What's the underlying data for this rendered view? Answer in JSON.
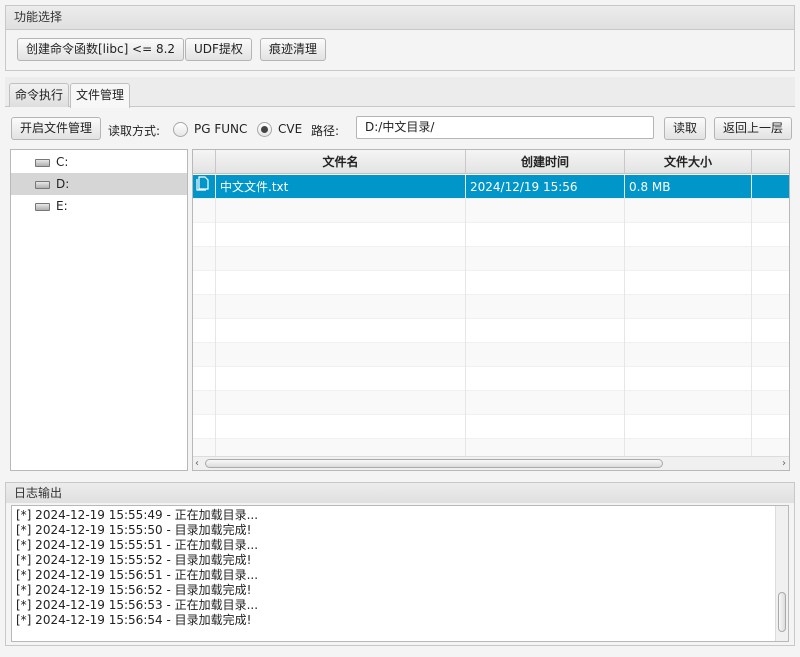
{
  "function_panel": {
    "title": "功能选择",
    "buttons": [
      "创建命令函数[libc] <= 8.2",
      "UDF提权",
      "痕迹清理"
    ]
  },
  "tabs": [
    "命令执行",
    "文件管理"
  ],
  "active_tab": "文件管理",
  "file_toolbar": {
    "open_button": "开启文件管理",
    "read_mode_label": "读取方式:",
    "mode_pg": "PG FUNC",
    "mode_cve": "CVE",
    "selected_mode": "CVE",
    "path_label": "路径:",
    "path_value": "D:/中文目录/",
    "read_button": "读取",
    "back_button": "返回上一层"
  },
  "drives": [
    "C:",
    "D:",
    "E:"
  ],
  "selected_drive": "D:",
  "table": {
    "columns": [
      "文件名",
      "创建时间",
      "文件大小"
    ],
    "rows": [
      {
        "name": "中文文件.txt",
        "created": "2024/12/19 15:56",
        "size": "0.8 MB",
        "icon": "file-icon"
      }
    ]
  },
  "log": {
    "title": "日志输出",
    "lines": [
      "[*] 2024-12-19 15:55:49 - 正在加载目录...",
      "[*] 2024-12-19 15:55:50 - 目录加载完成!",
      "[*] 2024-12-19 15:55:51 - 正在加载目录...",
      "[*] 2024-12-19 15:55:52 - 目录加载完成!",
      "[*] 2024-12-19 15:56:51 - 正在加载目录...",
      "[*] 2024-12-19 15:56:52 - 目录加载完成!",
      "[*] 2024-12-19 15:56:53 - 正在加载目录...",
      "[*] 2024-12-19 15:56:54 - 目录加载完成!"
    ]
  },
  "colors": {
    "selection": "#0096c9",
    "selected_drive_bg": "#d6d6d6"
  }
}
